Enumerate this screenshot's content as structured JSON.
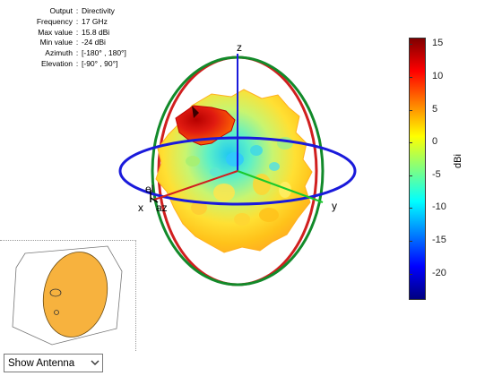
{
  "info": [
    {
      "key": "Output",
      "value": "Directivity"
    },
    {
      "key": "Frequency",
      "value": "17 GHz"
    },
    {
      "key": "Max value",
      "value": "15.8 dBi"
    },
    {
      "key": "Min value",
      "value": "-24 dBi"
    },
    {
      "key": "Azimuth",
      "value": "[-180° , 180°]"
    },
    {
      "key": "Elevation",
      "value": "[-90° , 90°]"
    }
  ],
  "axes": {
    "z": "z",
    "x": "x",
    "y": "y",
    "el": "el",
    "az": "az"
  },
  "colorbar": {
    "label": "dBi",
    "ticks": [
      "15",
      "10",
      "5",
      "0",
      "-5",
      "-10",
      "-15",
      "-20"
    ],
    "range": [
      -24,
      16
    ],
    "colormap": "jet"
  },
  "colors": {
    "x_ring": "#1a1adb",
    "y_ring": "#d01f1f",
    "z_ring": "#128a2a",
    "antenna": "#f5b942"
  },
  "view_select": {
    "selected": "Show Antenna"
  }
}
